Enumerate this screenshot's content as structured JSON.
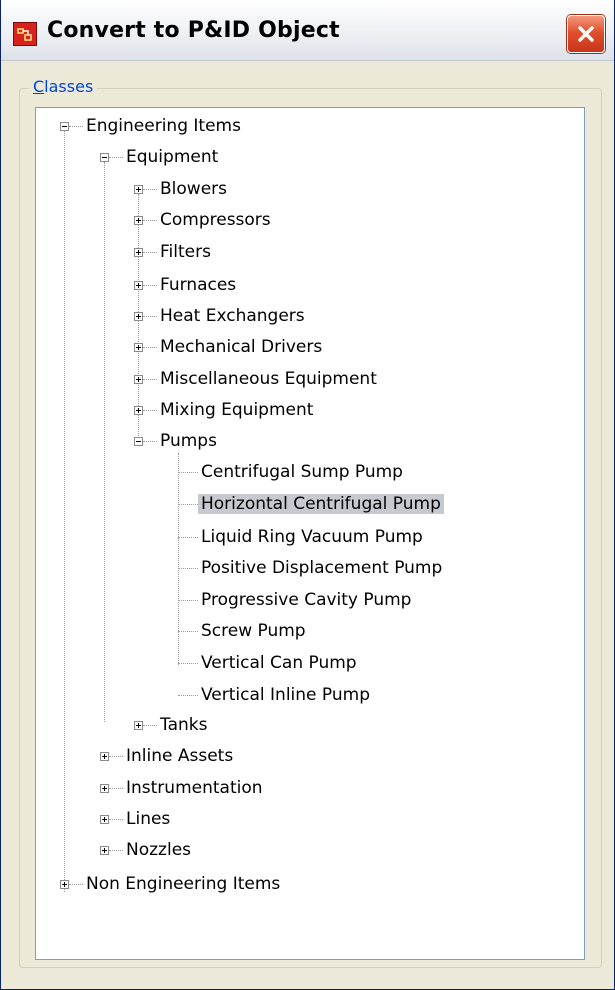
{
  "window": {
    "title": "Convert to P&ID Object"
  },
  "classes": {
    "legend_accel": "C",
    "legend_rest": "lasses"
  },
  "tree": {
    "engineering_items": "Engineering Items",
    "equipment": "Equipment",
    "blowers": "Blowers",
    "compressors": "Compressors",
    "filters": "Filters",
    "furnaces": "Furnaces",
    "heat_exchangers": "Heat Exchangers",
    "mechanical_drivers": "Mechanical Drivers",
    "miscellaneous_equipment": "Miscellaneous Equipment",
    "mixing_equipment": "Mixing Equipment",
    "pumps": "Pumps",
    "pump_items": [
      "Centrifugal Sump Pump",
      "Horizontal Centrifugal Pump",
      "Liquid Ring Vacuum Pump",
      "Positive Displacement Pump",
      "Progressive Cavity Pump",
      "Screw Pump",
      "Vertical Can Pump",
      "Vertical Inline Pump"
    ],
    "selected_item": "Horizontal Centrifugal Pump",
    "tanks": "Tanks",
    "inline_assets": "Inline Assets",
    "instrumentation": "Instrumentation",
    "lines": "Lines",
    "nozzles": "Nozzles",
    "non_engineering_items": "Non Engineering Items"
  },
  "colors": {
    "selection_background": "#c7c9d0",
    "close_button": "#d9462a",
    "accent_text": "#0046d5"
  }
}
